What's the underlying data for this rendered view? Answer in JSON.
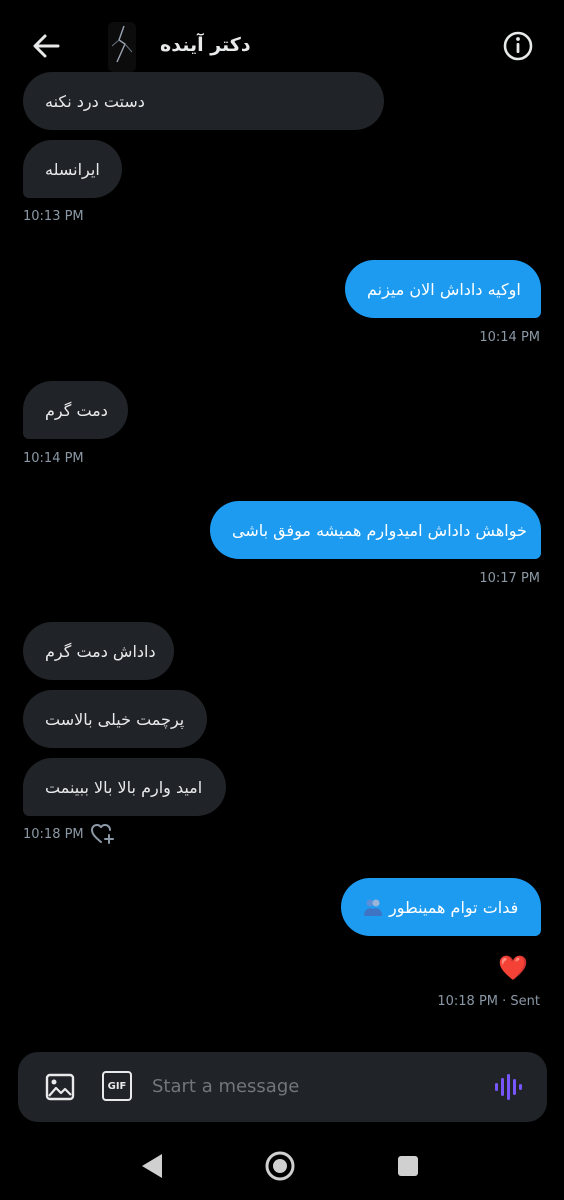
{
  "header": {
    "title": "دکتر آینده"
  },
  "messages": [
    {
      "text": "دستت درد نکنه"
    },
    {
      "text": "ایرانسله"
    },
    {
      "time": "10:13 PM"
    },
    {
      "text": "اوکیه داداش الان میزنم"
    },
    {
      "time": "10:14 PM"
    },
    {
      "text": "دمت گرم"
    },
    {
      "time": "10:14 PM"
    },
    {
      "text": "خواهش داداش امیدوارم همیشه موفق باشی"
    },
    {
      "time": "10:17 PM"
    },
    {
      "text": "داداش دمت گرم"
    },
    {
      "text": "پرچمت خیلی بالاست"
    },
    {
      "text": "امید وارم بالا بالا ببینمت"
    },
    {
      "time": "10:18 PM"
    },
    {
      "text": "فدات توام همینطور"
    },
    {
      "reaction": "❤️"
    },
    {
      "time": "10:18 PM · Sent"
    }
  ],
  "composer": {
    "placeholder": "Start a message",
    "gif_label": "GIF"
  },
  "colors": {
    "sent_bubble": "#1d9bf0",
    "received_bubble": "#202327",
    "voice_accent": "#7856ff",
    "reaction": "#d9202b"
  }
}
